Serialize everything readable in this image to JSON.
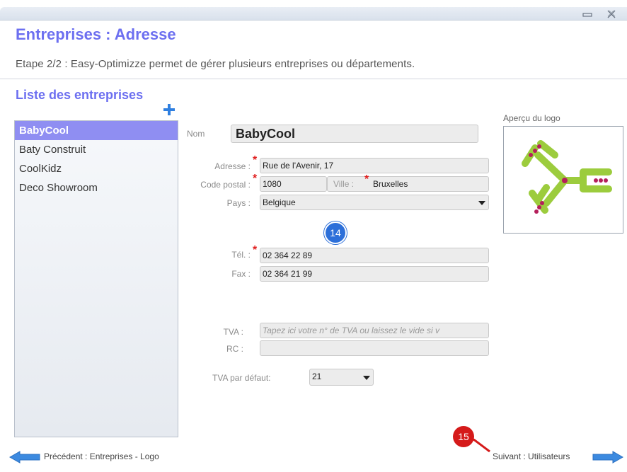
{
  "window": {
    "title": "Entreprises : Adresse",
    "subtitle": "Etape 2/2 : Easy-Optimizze permet de gérer plusieurs entreprises ou départements."
  },
  "sidebar": {
    "title": "Liste des entreprises",
    "items": [
      {
        "label": "BabyCool",
        "selected": true
      },
      {
        "label": "Baty Construit"
      },
      {
        "label": "CoolKidz"
      },
      {
        "label": "Deco Showroom"
      }
    ]
  },
  "form": {
    "nom_label": "Nom",
    "nom_value": "BabyCool",
    "adresse_label": "Adresse :",
    "adresse_value": "Rue de l'Avenir, 17",
    "code_postal_label": "Code postal :",
    "code_postal_value": "1080",
    "ville_label": "Ville :",
    "ville_value": "Bruxelles",
    "pays_label": "Pays :",
    "pays_value": "Belgique",
    "tel_label": "Tél. :",
    "tel_value": "02 364 22 89",
    "fax_label": "Fax :",
    "fax_value": "02 364 21 99",
    "tva_label": "TVA :",
    "tva_placeholder": "Tapez ici votre n° de TVA ou laissez le vide si v",
    "rc_label": "RC :",
    "rc_value": "",
    "tva_defaut_label": "TVA par défaut:",
    "tva_defaut_value": "21",
    "required_marker": "*"
  },
  "logo": {
    "label": "Aperçu du logo"
  },
  "badges": {
    "b14": "14",
    "b15": "15"
  },
  "footer": {
    "prev_label": "Précédent : Entreprises - Logo",
    "next_label": "Suivant : Utilisateurs"
  },
  "colors": {
    "accent": "#6c6ff0",
    "selected": "#8f8ef2",
    "required": "#e01e1e",
    "badge_blue": "#2c6fd9",
    "badge_red": "#d51a1a"
  },
  "icons": [
    "minimize-icon",
    "close-icon",
    "plus-icon",
    "arrow-left-icon",
    "arrow-right-icon",
    "dropdown-arrow-icon"
  ]
}
